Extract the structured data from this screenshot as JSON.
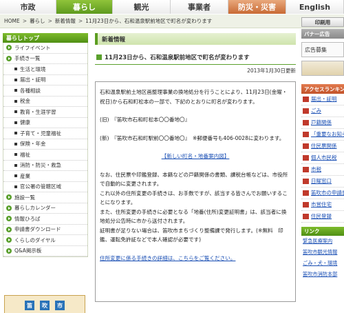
{
  "topnav": [
    "市政",
    "暮らし",
    "観光",
    "事業者",
    "防災・災害",
    "English"
  ],
  "breadcrumb": [
    "HOME",
    "暮らし",
    "新着情報",
    "11月23日から、石和温泉駅前地区で町名が変わります"
  ],
  "print_label": "印刷用",
  "sidebar": {
    "title": "暮らしトップ",
    "items": [
      {
        "label": "ライフイベント",
        "kind": "top"
      },
      {
        "label": "手続き一覧",
        "kind": "top"
      },
      {
        "label": "生活と環境",
        "kind": "sub"
      },
      {
        "label": "届出・証明",
        "kind": "sub"
      },
      {
        "label": "各種相談",
        "kind": "sub"
      },
      {
        "label": "税金",
        "kind": "sub"
      },
      {
        "label": "教育・生涯学習",
        "kind": "sub"
      },
      {
        "label": "健康",
        "kind": "sub"
      },
      {
        "label": "子育て・児童福祉",
        "kind": "sub"
      },
      {
        "label": "保険・年金",
        "kind": "sub"
      },
      {
        "label": "福祉",
        "kind": "sub"
      },
      {
        "label": "消防・防災・救急",
        "kind": "sub"
      },
      {
        "label": "産業",
        "kind": "sub"
      },
      {
        "label": "官公署の管轄区域",
        "kind": "sub"
      },
      {
        "label": "施設一覧",
        "kind": "top"
      },
      {
        "label": "暮らしカレンダー",
        "kind": "top"
      },
      {
        "label": "情報ひろば",
        "kind": "top"
      },
      {
        "label": "申請書ダウンロード",
        "kind": "top"
      },
      {
        "label": "くらしのダイヤル",
        "kind": "top"
      },
      {
        "label": "Q&A掲示板",
        "kind": "top"
      }
    ],
    "banner_chars": [
      "笛",
      "吹",
      "市"
    ]
  },
  "main": {
    "section_title": "新着情報",
    "article_title": "11月23日から、石和温泉駅前地区で町名が変わります",
    "date": "2013年1月30日更新",
    "paragraphs": {
      "p1": "石和温泉駅前土地区画整理事業の換地処分を行うことにより、11月23日(金曜・祝日)から石和町松本の一部で、下記のとおりに町名が変わります。",
      "old": "(旧)　『笛吹市石和町松本〇〇番地〇』",
      "new": "(新)　『笛吹市石和町駅前〇〇番地〇』　※郵便番号も406-0028に変わります。",
      "link": "【新しい町名・地番案内図】",
      "p2": "なお、住民票や印鑑登録、本籍などの戸籍関係の書類、課税台帳などは、市役所で自動的に変更されます。",
      "p3": "これ以外の住所変更の手続きは、お手数ですが、該当する皆さんでお願いすることになります。",
      "p4": "また、住所変更の手続きに必要となる「地番(住所)変更証明書」は、該当者に換地処分公告時に市から送付されます。",
      "p5": "証明書が足りない場合は、笛吹市まちづくり整備課で発行します。(※無料　印鑑、運転免許証などで本人確認が必要です)",
      "p6": "住所変更に係る手続きの詳細は、こちらをご覧ください。"
    }
  },
  "right": {
    "ad_title": "バナー広告",
    "ad_box": "広告募集",
    "rank_title": "アクセスランキング",
    "rank_items": [
      "届出・証明",
      "ごみ",
      "戸籍関係",
      "「重要なお知らせ」ケンピーターの補助金の交付対象の地権について",
      "住民票関係",
      "個人市民税",
      "市税",
      "日曜窓口",
      "笛吹市の申請書(2月26日)",
      "市営住宅",
      "住民登録"
    ],
    "link_title": "リンク",
    "links": [
      "緊急医療案内",
      "笛吹市観光情報",
      "ごみ・犬・環境",
      "笛吹市消防本部"
    ]
  }
}
